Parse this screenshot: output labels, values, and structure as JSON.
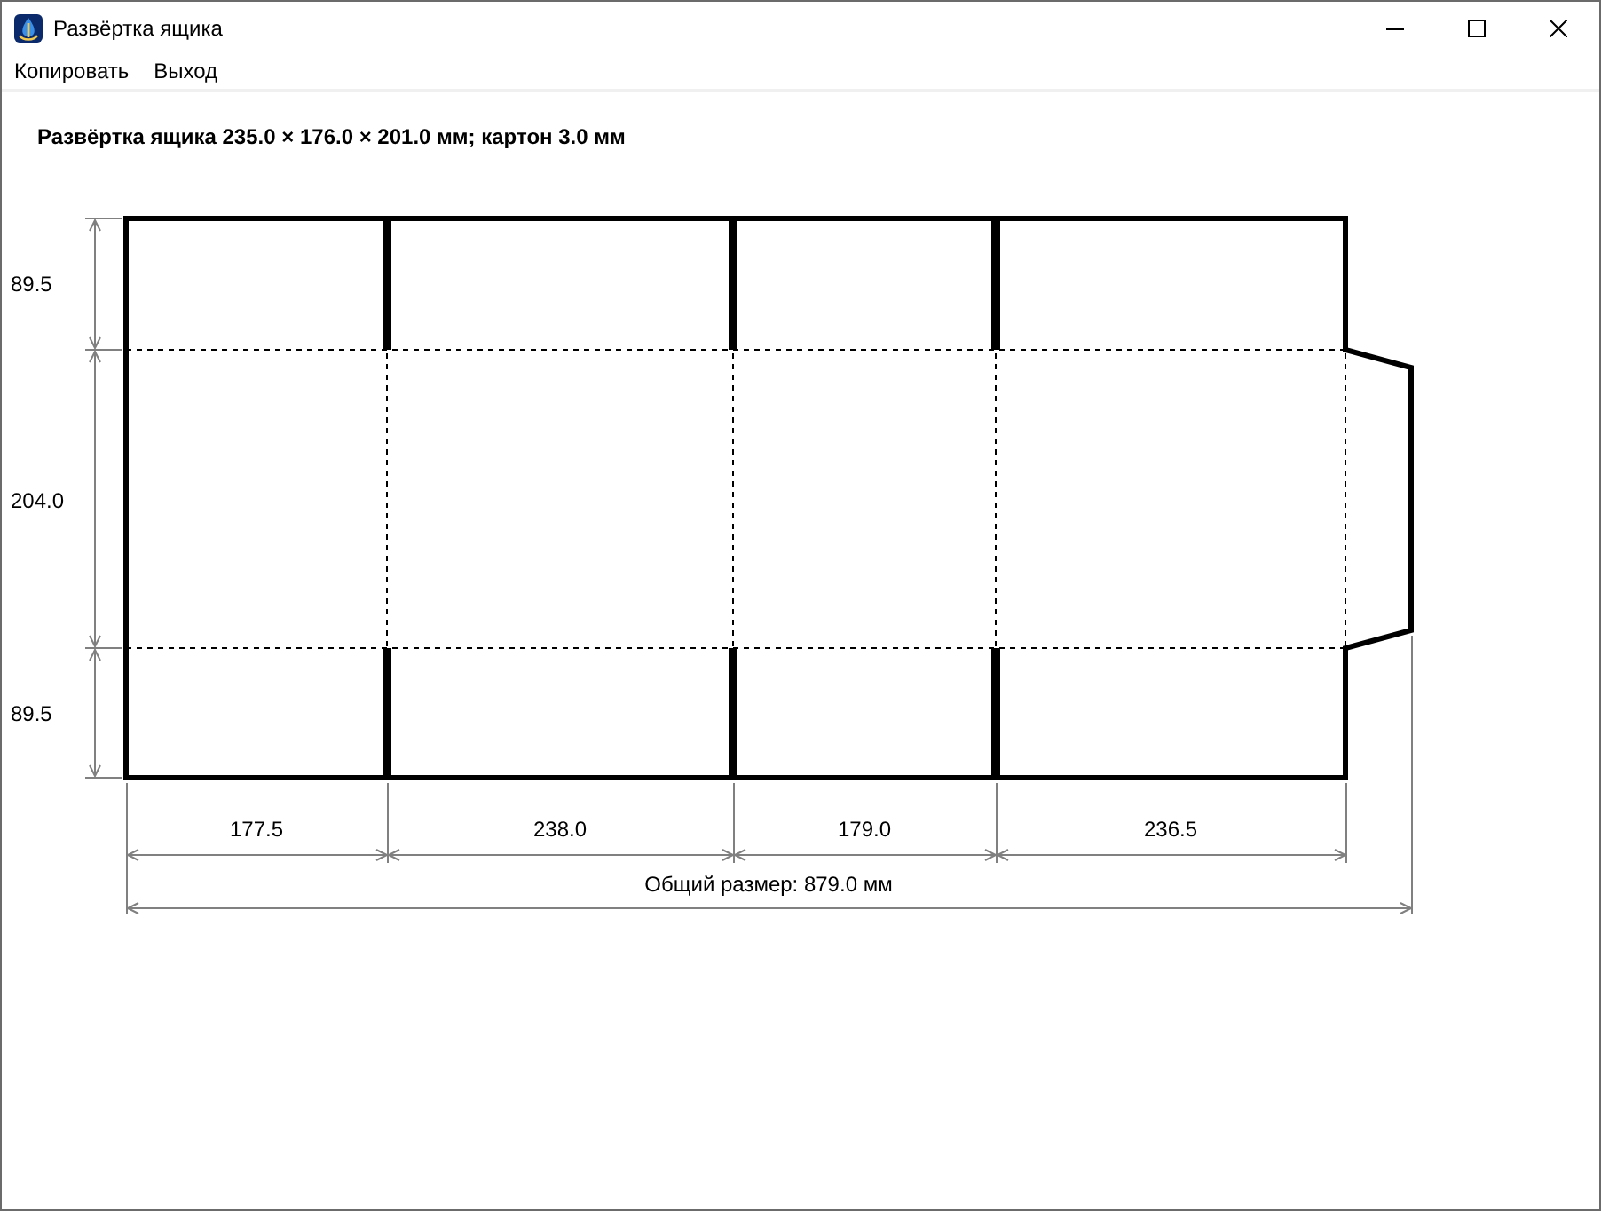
{
  "window": {
    "title": "Развёртка ящика"
  },
  "menu": [
    {
      "label": "Копировать"
    },
    {
      "label": "Выход"
    }
  ],
  "drawing": {
    "heading": "Развёртка ящика 235.0 × 176.0 × 201.0 мм; картон 3.0 мм",
    "height_dimensions": [
      "89.5",
      "204.0",
      "89.5"
    ],
    "width_dimensions": [
      "177.5",
      "238.0",
      "179.0",
      "236.5"
    ],
    "total_dimension": "Общий размер: 879.0 мм"
  }
}
